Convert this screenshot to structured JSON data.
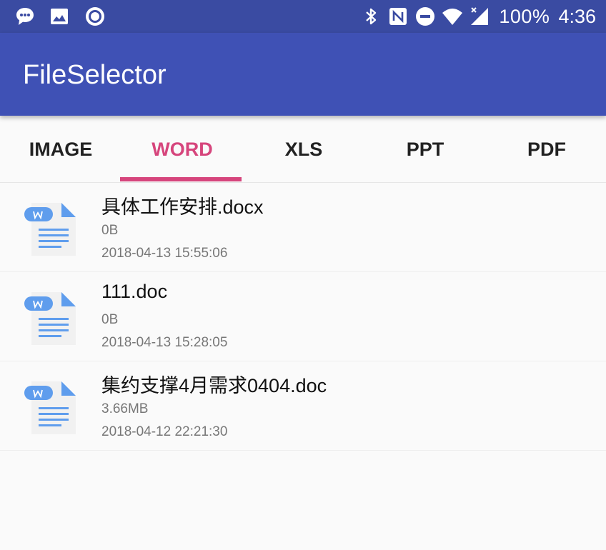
{
  "status_bar": {
    "icons_left": [
      "message-icon",
      "image-icon",
      "record-icon"
    ],
    "icons_right": [
      "bluetooth-icon",
      "nfc-icon",
      "do-not-disturb-icon",
      "wifi-icon",
      "signal-icon"
    ],
    "battery": "100%",
    "time": "4:36"
  },
  "app_bar": {
    "title": "FileSelector",
    "color": "#3f51b5"
  },
  "tabs": {
    "active_index": 1,
    "accent": "#d6457c",
    "items": [
      {
        "label": "IMAGE"
      },
      {
        "label": "WORD"
      },
      {
        "label": "XLS"
      },
      {
        "label": "PPT"
      },
      {
        "label": "PDF"
      }
    ]
  },
  "files": [
    {
      "name": "具体工作安排.docx",
      "size": "0B",
      "date": "2018-04-13 15:55:06",
      "icon": "word-doc-icon"
    },
    {
      "name": "111.doc",
      "size": "0B",
      "date": "2018-04-13 15:28:05",
      "icon": "word-doc-icon"
    },
    {
      "name": "集约支撑4月需求0404.doc",
      "size": "3.66MB",
      "date": "2018-04-12 22:21:30",
      "icon": "word-doc-icon"
    }
  ]
}
